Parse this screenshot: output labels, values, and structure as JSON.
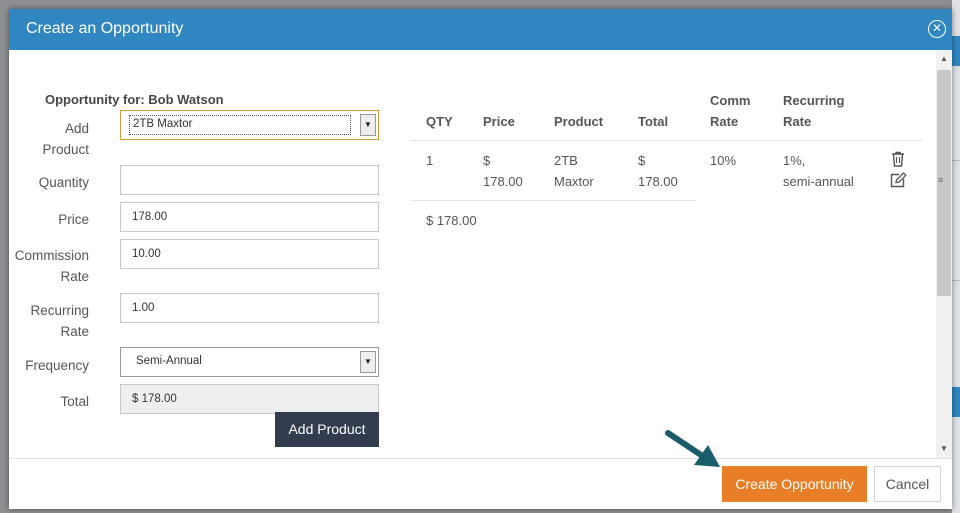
{
  "modal": {
    "title": "Create an Opportunity",
    "close_icon": "close-circle-icon"
  },
  "form": {
    "section_title": "Opportunity for: Bob Watson",
    "add_product": {
      "label_line1": "Add",
      "label_line2": "Product",
      "value": "2TB Maxtor"
    },
    "quantity": {
      "label": "Quantity",
      "value": ""
    },
    "price": {
      "label": "Price",
      "value": "178.00"
    },
    "commission_rate": {
      "label_line1": "Commission",
      "label_line2": "Rate",
      "value": "10.00"
    },
    "recurring_rate": {
      "label_line1": "Recurring",
      "label_line2": "Rate",
      "value": "1.00"
    },
    "frequency": {
      "label": "Frequency",
      "value": "Semi-Annual"
    },
    "total": {
      "label": "Total",
      "value": "$ 178.00"
    },
    "add_button": "Add Product"
  },
  "table": {
    "headers": {
      "qty": "QTY",
      "price": "Price",
      "product": "Product",
      "total": "Total",
      "comm_l1": "Comm",
      "comm_l2": "Rate",
      "rec_l1": "Recurring",
      "rec_l2": "Rate"
    },
    "rows": [
      {
        "qty": "1",
        "price_l1": "$",
        "price_l2": "178.00",
        "product_l1": "2TB",
        "product_l2": "Maxtor",
        "total_l1": "$",
        "total_l2": "178.00",
        "comm": "10%",
        "rec_l1": "1%,",
        "rec_l2": "semi-annual",
        "delete_icon": "trash-icon",
        "edit_icon": "edit-icon"
      }
    ],
    "grand_total": "$ 178.00"
  },
  "footer": {
    "create_button": "Create Opportunity",
    "cancel_button": "Cancel"
  },
  "colors": {
    "header": "#2f86c1",
    "primary_button": "#e87e27",
    "dark_button": "#323c4f",
    "arrow": "#1b5e6b"
  }
}
